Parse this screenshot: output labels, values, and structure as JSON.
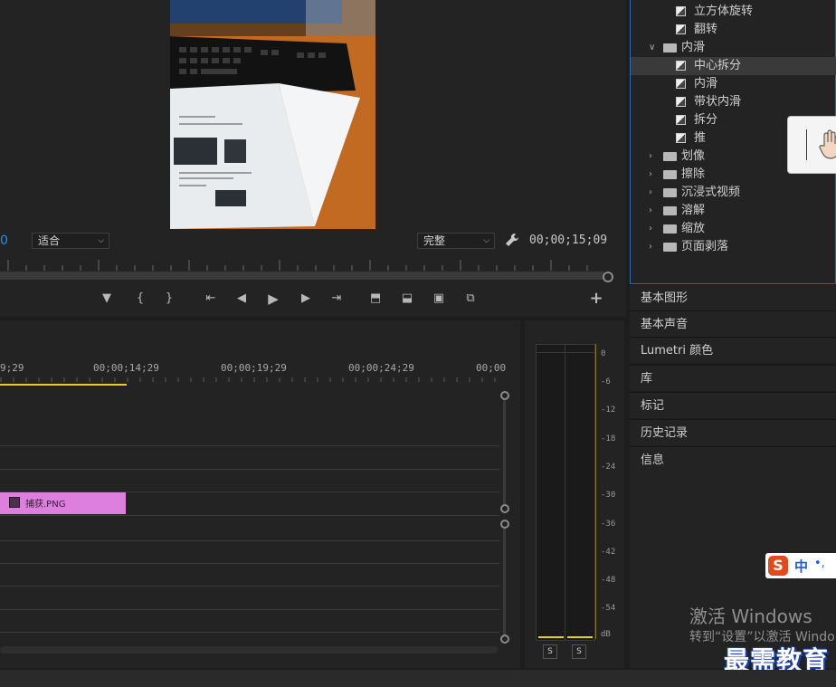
{
  "program_monitor": {
    "timecode_left": "0",
    "zoom_select": "适合",
    "resolution_select": "完整",
    "timecode_right": "00;00;15;09"
  },
  "timeline": {
    "ruler_labels": [
      "9;29",
      "00;00;14;29",
      "00;00;19;29",
      "00;00;24;29",
      "00;00"
    ],
    "clip": {
      "name": "捕获.PNG",
      "color": "#dd7fdd"
    }
  },
  "audio_meter": {
    "db_labels": [
      "0",
      "-6",
      "-12",
      "-18",
      "-24",
      "-30",
      "-36",
      "-42",
      "-48",
      "-54",
      "dB"
    ],
    "solo_labels": [
      "S",
      "S"
    ]
  },
  "effects": {
    "rows": [
      {
        "label": "立方体旋转",
        "kind": "effect",
        "selected": false
      },
      {
        "label": "翻转",
        "kind": "effect",
        "selected": false
      },
      {
        "label": "内滑",
        "kind": "folder-open",
        "selected": false
      },
      {
        "label": "中心拆分",
        "kind": "effect",
        "selected": true
      },
      {
        "label": "内滑",
        "kind": "effect",
        "selected": false
      },
      {
        "label": "带状内滑",
        "kind": "effect",
        "selected": false
      },
      {
        "label": "拆分",
        "kind": "effect",
        "selected": false
      },
      {
        "label": "推",
        "kind": "effect",
        "selected": false
      },
      {
        "label": "划像",
        "kind": "folder",
        "selected": false
      },
      {
        "label": "擦除",
        "kind": "folder",
        "selected": false
      },
      {
        "label": "沉浸式视频",
        "kind": "folder",
        "selected": false
      },
      {
        "label": "溶解",
        "kind": "folder",
        "selected": false
      },
      {
        "label": "缩放",
        "kind": "folder",
        "selected": false
      },
      {
        "label": "页面剥落",
        "kind": "folder",
        "selected": false
      }
    ]
  },
  "panels": [
    "基本图形",
    "基本声音",
    "Lumetri 颜色",
    "库",
    "标记",
    "历史记录",
    "信息"
  ],
  "ime": {
    "lang": "中",
    "punct": "•,"
  },
  "activation": {
    "title": "激活 Windows",
    "subtitle": "转到“设置”以激活 Windo"
  },
  "watermark": "最需教育",
  "colors": {
    "accent_blue": "#2d8ceb",
    "playhead_yellow": "#e6d020",
    "panel_border": "#2f6bb0"
  }
}
